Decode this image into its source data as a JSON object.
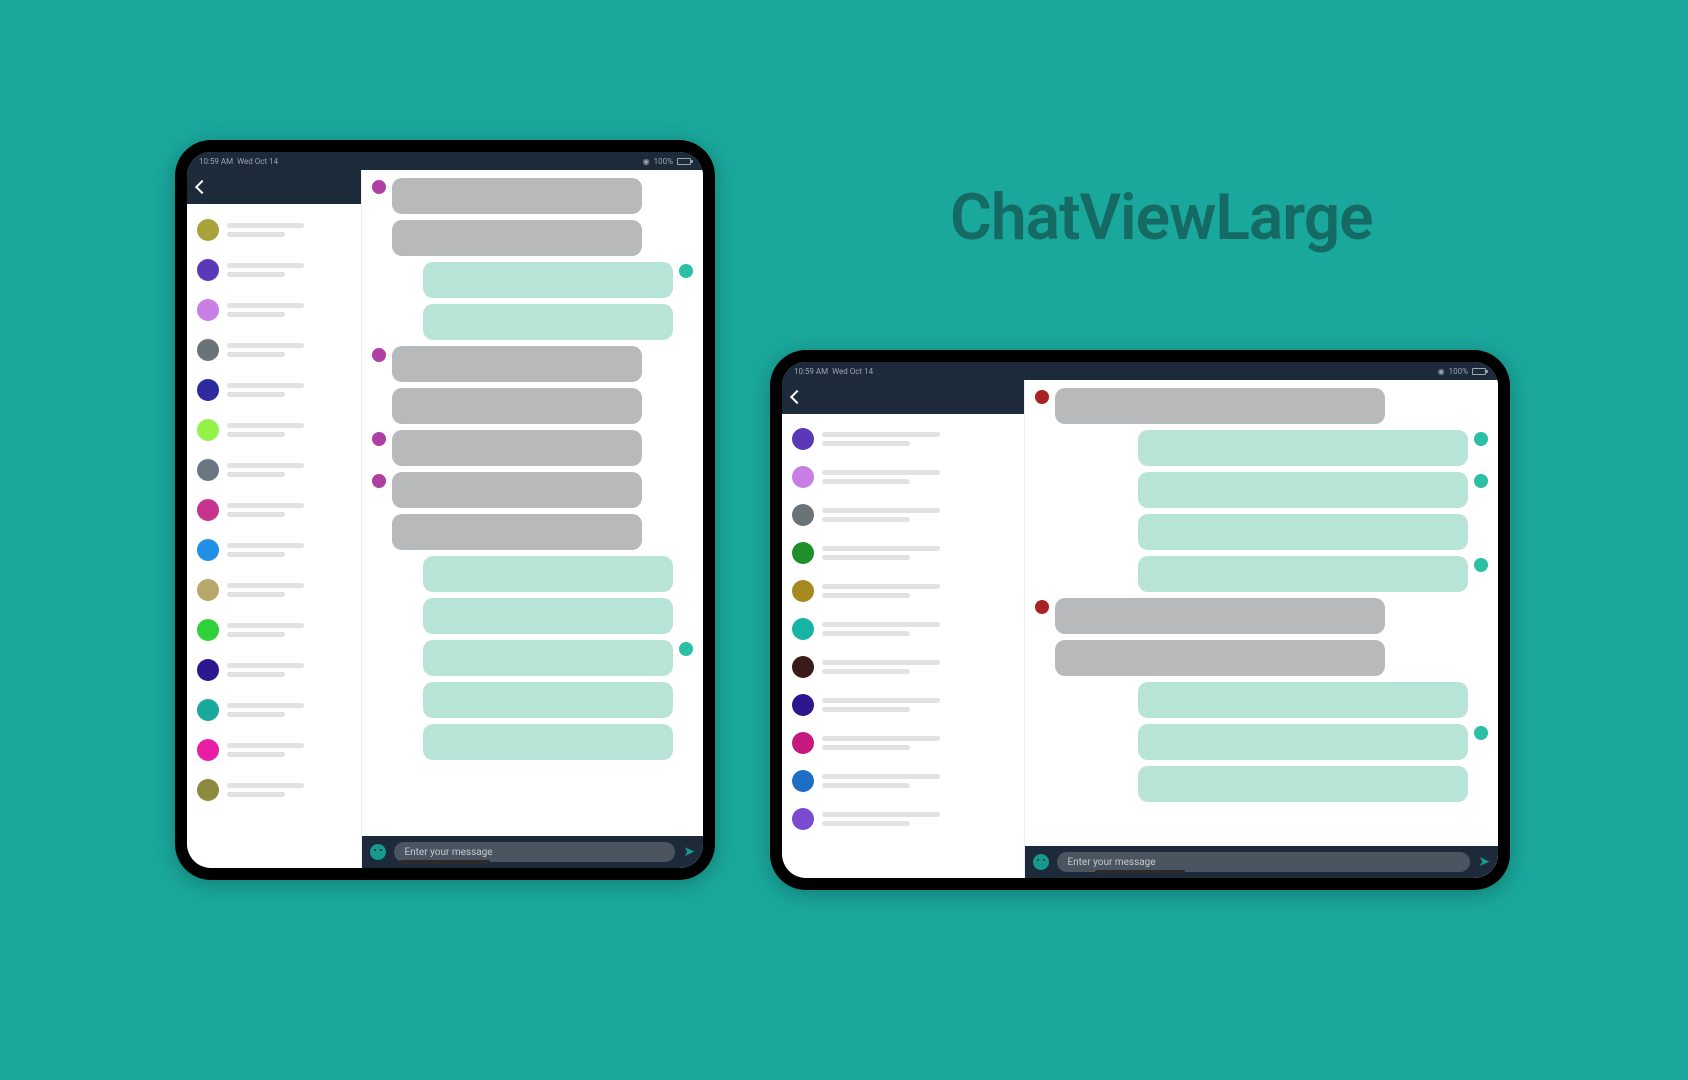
{
  "title": "ChatViewLarge",
  "statusbar": {
    "time": "10:59 AM",
    "date": "Wed Oct 14",
    "battery": "100%"
  },
  "composer": {
    "placeholder": "Enter your message"
  },
  "colors": {
    "bg": "#1aa79c",
    "header": "#1c2a3a",
    "bubble_in": "#b7b9bb",
    "bubble_out": "#b7e4d6",
    "accent_out": "#2bbfa3",
    "accent_in_magenta": "#b03fa3",
    "accent_in_red": "#a92323"
  },
  "portrait": {
    "threads": [
      {
        "color": "#a7a23a"
      },
      {
        "color": "#5a38b7"
      },
      {
        "color": "#c97ee6"
      },
      {
        "color": "#6a7377"
      },
      {
        "color": "#2e2aa0"
      },
      {
        "color": "#93f24a"
      },
      {
        "color": "#6a7682"
      },
      {
        "color": "#c6348f"
      },
      {
        "color": "#1e90e6"
      },
      {
        "color": "#b8a76a"
      },
      {
        "color": "#2fd13a"
      },
      {
        "color": "#2c178f"
      },
      {
        "color": "#1aa79c"
      },
      {
        "color": "#e81ea5"
      },
      {
        "color": "#8c8a3c"
      }
    ],
    "messages": [
      {
        "side": "in",
        "avatar": "#b03fa3"
      },
      {
        "side": "in"
      },
      {
        "side": "out",
        "avatar": "#2bbfa3"
      },
      {
        "side": "out"
      },
      {
        "side": "in",
        "avatar": "#b03fa3"
      },
      {
        "side": "in"
      },
      {
        "side": "in",
        "avatar": "#b03fa3"
      },
      {
        "side": "in",
        "avatar": "#b03fa3"
      },
      {
        "side": "in"
      },
      {
        "side": "out"
      },
      {
        "side": "out"
      },
      {
        "side": "out",
        "avatar": "#2bbfa3"
      },
      {
        "side": "out"
      },
      {
        "side": "out"
      }
    ]
  },
  "landscape": {
    "threads": [
      {
        "color": "#5a38b7"
      },
      {
        "color": "#c97ee6"
      },
      {
        "color": "#6a7377"
      },
      {
        "color": "#1f8f2a"
      },
      {
        "color": "#a78a1f"
      },
      {
        "color": "#17b3a6"
      },
      {
        "color": "#3b1a1a"
      },
      {
        "color": "#2c178f"
      },
      {
        "color": "#c6187f"
      },
      {
        "color": "#1f6ec6"
      },
      {
        "color": "#7a4bd0"
      }
    ],
    "messages": [
      {
        "side": "in",
        "avatar": "#a92323"
      },
      {
        "side": "out",
        "avatar": "#2bbfa3"
      },
      {
        "side": "out",
        "avatar": "#2bbfa3"
      },
      {
        "side": "out"
      },
      {
        "side": "out",
        "avatar": "#2bbfa3"
      },
      {
        "side": "in",
        "avatar": "#a92323"
      },
      {
        "side": "in"
      },
      {
        "side": "out"
      },
      {
        "side": "out",
        "avatar": "#2bbfa3"
      },
      {
        "side": "out"
      }
    ]
  }
}
